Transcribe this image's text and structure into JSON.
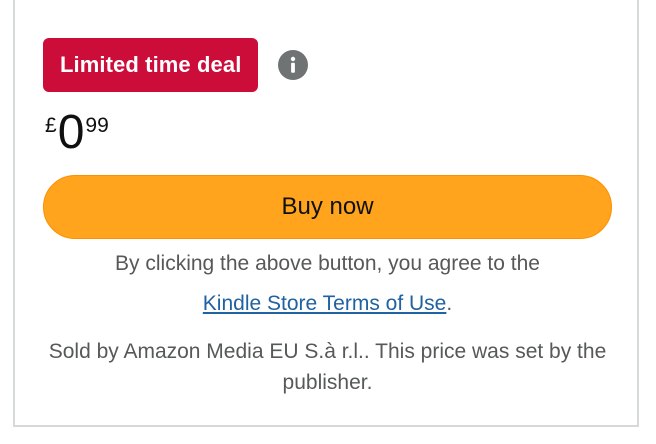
{
  "deal": {
    "badge_label": "Limited time deal",
    "info_icon": "info-icon"
  },
  "price": {
    "currency_symbol": "£",
    "whole": "0",
    "fraction": "99"
  },
  "buy_button": {
    "label": "Buy now"
  },
  "terms": {
    "prefix": "By clicking the above button, you agree to the",
    "link_text": "Kindle Store Terms of Use",
    "suffix": "."
  },
  "sold_by": {
    "text": "Sold by Amazon Media EU S.à r.l.. This price was set by the publisher."
  },
  "colors": {
    "deal_badge": "#cc0c39",
    "buy_button": "#ffa41c",
    "link": "#2162a1",
    "secondary_text": "#565959",
    "border": "#d5d9d9"
  }
}
